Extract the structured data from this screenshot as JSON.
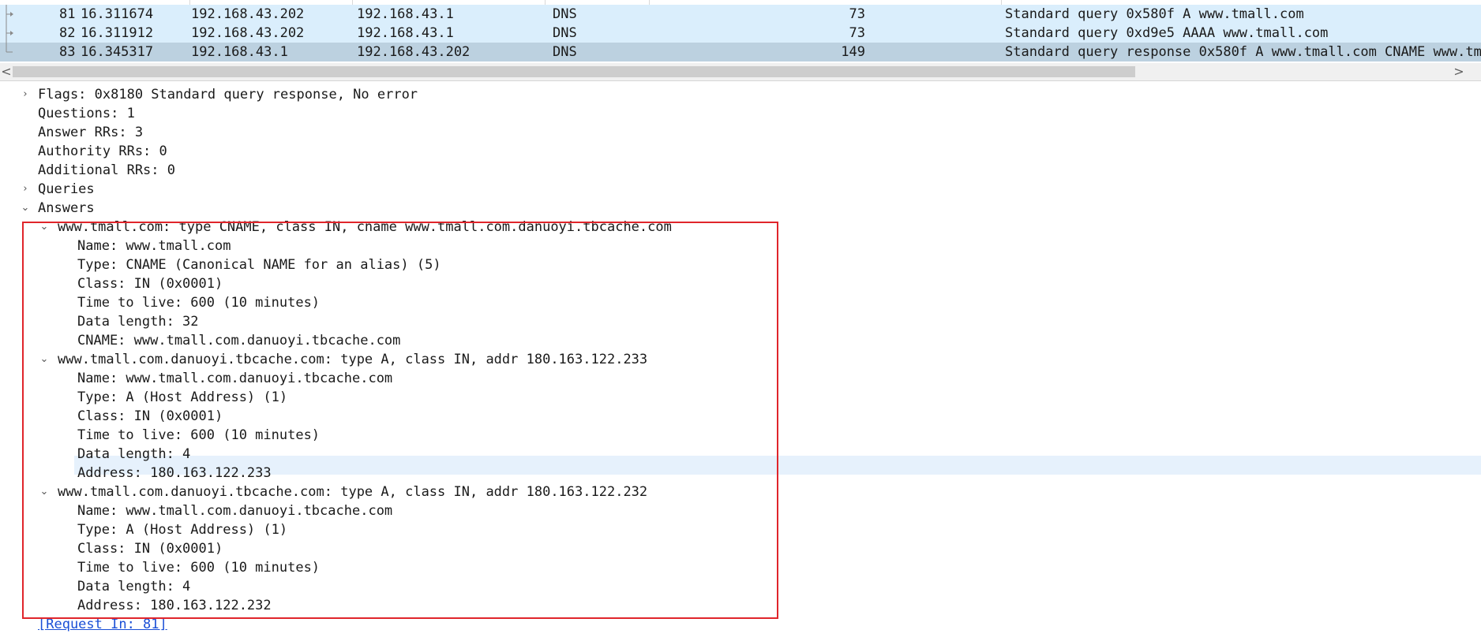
{
  "packets": [
    {
      "no": "81",
      "time": "16.311674",
      "source": "192.168.43.202",
      "destination": "192.168.43.1",
      "protocol": "DNS",
      "length": "73",
      "info": "Standard query 0x580f A www.tmall.com"
    },
    {
      "no": "82",
      "time": "16.311912",
      "source": "192.168.43.202",
      "destination": "192.168.43.1",
      "protocol": "DNS",
      "length": "73",
      "info": "Standard query 0xd9e5 AAAA www.tmall.com"
    },
    {
      "no": "83",
      "time": "16.345317",
      "source": "192.168.43.1",
      "destination": "192.168.43.202",
      "protocol": "DNS",
      "length": "149",
      "info": "Standard query response 0x580f A www.tmall.com CNAME www.tm"
    }
  ],
  "scrollbar": {
    "left_arrow": "<",
    "right_arrow": ">"
  },
  "details": {
    "flags": "Flags: 0x8180 Standard query response, No error",
    "questions": "Questions: 1",
    "answer_rrs": "Answer RRs: 3",
    "authority_rrs": "Authority RRs: 0",
    "additional_rrs": "Additional RRs: 0",
    "queries": "Queries",
    "answers": "Answers",
    "answer_list": [
      {
        "header": "www.tmall.com: type CNAME, class IN, cname www.tmall.com.danuoyi.tbcache.com",
        "fields": [
          "Name: www.tmall.com",
          "Type: CNAME (Canonical NAME for an alias) (5)",
          "Class: IN (0x0001)",
          "Time to live: 600 (10 minutes)",
          "Data length: 32",
          "CNAME: www.tmall.com.danuoyi.tbcache.com"
        ]
      },
      {
        "header": "www.tmall.com.danuoyi.tbcache.com: type A, class IN, addr 180.163.122.233",
        "fields": [
          "Name: www.tmall.com.danuoyi.tbcache.com",
          "Type: A (Host Address) (1)",
          "Class: IN (0x0001)",
          "Time to live: 600 (10 minutes)",
          "Data length: 4",
          "Address: 180.163.122.233"
        ]
      },
      {
        "header": "www.tmall.com.danuoyi.tbcache.com: type A, class IN, addr 180.163.122.232",
        "fields": [
          "Name: www.tmall.com.danuoyi.tbcache.com",
          "Type: A (Host Address) (1)",
          "Class: IN (0x0001)",
          "Time to live: 600 (10 minutes)",
          "Data length: 4",
          "Address: 180.163.122.232"
        ]
      }
    ],
    "request_in": "[Request In: 81]"
  },
  "colors": {
    "selected_row": "#bcd1e0",
    "related_row": "#daeefc",
    "highlight_box": "#e0252b",
    "link": "#1a4fd6"
  },
  "icons": {
    "expanded": "chevron-down-icon",
    "collapsed": "chevron-right-icon"
  }
}
